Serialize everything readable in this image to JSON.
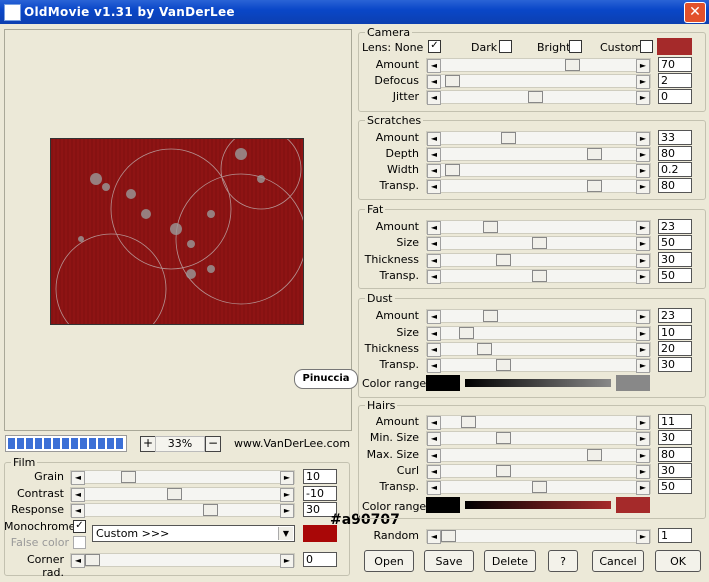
{
  "window": {
    "title": "OldMovie v1.31 by VanDerLee"
  },
  "preview": {
    "watermark": "Pinuccia",
    "zoom": "33%",
    "zoom_in": "+",
    "zoom_out": "−",
    "url": "www.VanDerLee.com",
    "progress": 1.0
  },
  "film": {
    "title": "Film",
    "sliders": [
      {
        "label": "Grain",
        "value": "10",
        "pos": 0.2
      },
      {
        "label": "Contrast",
        "value": "-10",
        "pos": 0.45
      },
      {
        "label": "Response",
        "value": "30",
        "pos": 0.65
      },
      {
        "label": "Corner rad.",
        "value": "0",
        "pos": 0.0
      }
    ],
    "monochrome_label": "Monochrome",
    "false_color_label": "False color",
    "custom_select": "Custom >>>",
    "color": "#a90707",
    "color_hex_label": "#a90707"
  },
  "camera": {
    "title": "Camera",
    "lens_label": "Lens: None",
    "dark_label": "Dark",
    "bright_label": "Bright",
    "custom_label": "Custom",
    "custom_color": "#a52a2a",
    "sliders": [
      {
        "label": "Amount",
        "value": "70",
        "pos": 0.68
      },
      {
        "label": "Defocus",
        "value": "2",
        "pos": 0.02
      },
      {
        "label": "Jitter",
        "value": "0",
        "pos": 0.48
      }
    ]
  },
  "scratches": {
    "title": "Scratches",
    "sliders": [
      {
        "label": "Amount",
        "value": "33",
        "pos": 0.33
      },
      {
        "label": "Depth",
        "value": "80",
        "pos": 0.8
      },
      {
        "label": "Width",
        "value": "0.2",
        "pos": 0.02
      },
      {
        "label": "Transp.",
        "value": "80",
        "pos": 0.8
      }
    ]
  },
  "fat": {
    "title": "Fat",
    "sliders": [
      {
        "label": "Amount",
        "value": "23",
        "pos": 0.23
      },
      {
        "label": "Size",
        "value": "50",
        "pos": 0.5
      },
      {
        "label": "Thickness",
        "value": "30",
        "pos": 0.3
      },
      {
        "label": "Transp.",
        "value": "50",
        "pos": 0.5
      }
    ]
  },
  "dust": {
    "title": "Dust",
    "sliders": [
      {
        "label": "Amount",
        "value": "23",
        "pos": 0.23
      },
      {
        "label": "Size",
        "value": "10",
        "pos": 0.1
      },
      {
        "label": "Thickness",
        "value": "20",
        "pos": 0.2
      },
      {
        "label": "Transp.",
        "value": "30",
        "pos": 0.3
      }
    ],
    "color_range_label": "Color range",
    "color_start": "#000000",
    "color_end": "#888888"
  },
  "hairs": {
    "title": "Hairs",
    "sliders": [
      {
        "label": "Amount",
        "value": "11",
        "pos": 0.11
      },
      {
        "label": "Min. Size",
        "value": "30",
        "pos": 0.3
      },
      {
        "label": "Max. Size",
        "value": "80",
        "pos": 0.8
      },
      {
        "label": "Curl",
        "value": "30",
        "pos": 0.3
      },
      {
        "label": "Transp.",
        "value": "50",
        "pos": 0.5
      }
    ],
    "color_range_label": "Color range",
    "color_start": "#000000",
    "color_end": "#a52a2a"
  },
  "random": {
    "label": "Random",
    "value": "1",
    "pos": 0.0
  },
  "buttons": {
    "open": "Open",
    "save": "Save",
    "delete": "Delete",
    "help": "?",
    "cancel": "Cancel",
    "ok": "OK"
  }
}
